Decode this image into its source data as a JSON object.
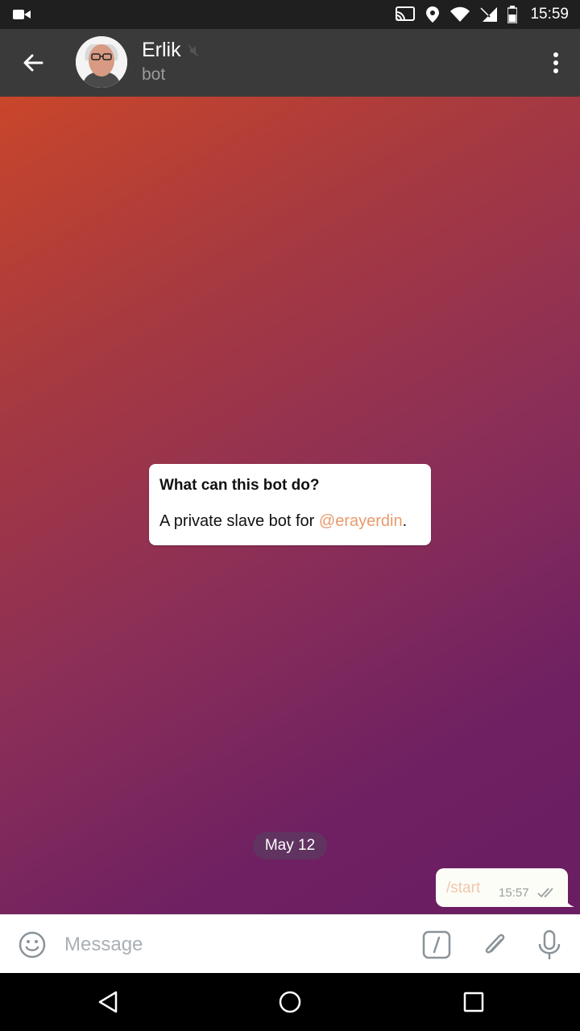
{
  "status_bar": {
    "time": "15:59",
    "icons": [
      "video-camera-icon",
      "cast-icon",
      "location-icon",
      "wifi-icon",
      "signal-icon",
      "battery-icon"
    ]
  },
  "header": {
    "title": "Erlik",
    "subtitle": "bot",
    "icons": [
      "back-arrow-icon",
      "muted-icon",
      "more-vert-icon"
    ]
  },
  "bot_info": {
    "title": "What can this bot do?",
    "text_prefix": "A private slave bot for ",
    "mention": "@erayerdin",
    "text_suffix": "."
  },
  "date_separator": "May 12",
  "message": {
    "text": "/start",
    "time": "15:57",
    "status_icon": "double-check-icon"
  },
  "input": {
    "placeholder": "Message",
    "icons": [
      "emoji-icon",
      "bot-command-icon",
      "attach-icon",
      "microphone-icon"
    ]
  },
  "nav_bar": {
    "icons": [
      "nav-back-icon",
      "nav-home-icon",
      "nav-recents-icon"
    ]
  },
  "colors": {
    "app_bar": "#3a3a3a",
    "link": "#e89a6c",
    "gradient_top": "#c9462a",
    "gradient_bottom": "#6a1d62"
  }
}
